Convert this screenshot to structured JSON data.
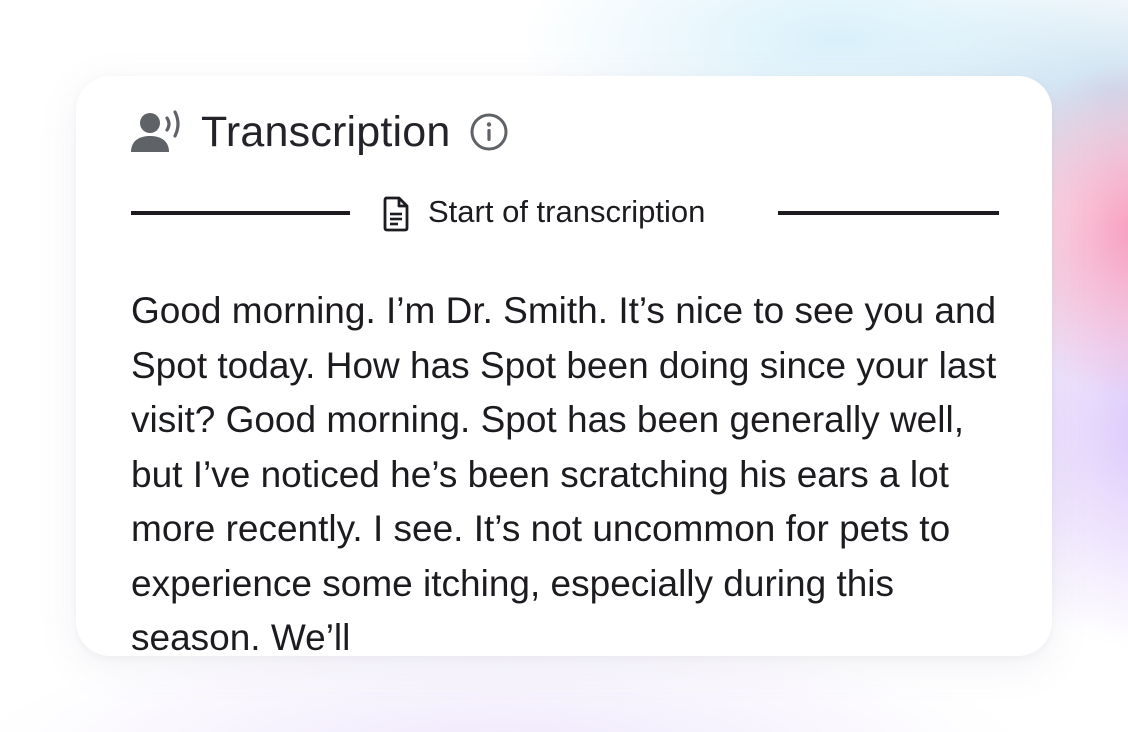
{
  "header": {
    "icon": "record-voice-icon",
    "title": "Transcription",
    "info_icon": "info-icon"
  },
  "divider": {
    "icon": "document-icon",
    "label": "Start of transcription"
  },
  "transcript": {
    "text": "Good morning. I’m Dr. Smith. It’s nice to see you and Spot today. How has Spot been doing since your last visit?  Good morning. Spot has been generally well, but I’ve noticed he’s been scratching his ears a lot more recently.  I see. It’s not uncommon for pets to experience some itching, especially during this season. We’ll"
  },
  "colors": {
    "text": "#1d1b20",
    "icon": "#5f6368",
    "card": "#ffffff"
  }
}
